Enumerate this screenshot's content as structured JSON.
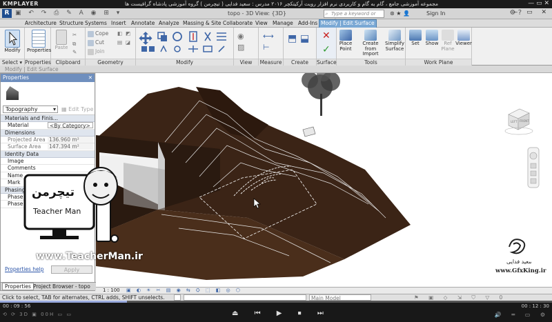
{
  "player": {
    "logo": "KMPLAYER",
    "title": "مجموعه آموزشی جامع ، گام به گام و کاربردی نرم افزار رویت آرکیتکچر ۲۰۱۶ مدرس : سعید فدایی ( تیچرمن ) گروه آموزشی پادشاه گرافیست ها",
    "elapsed": "00 : 09 : 56",
    "total": "00 : 12 : 30",
    "progress": 0.23,
    "left_buttons": "⟲ ⟳ 3D ▣ 00H ▭ ▭",
    "controls": "⏏ ⏮ ▶ ⏹ ⏭",
    "right_buttons": "🔊 ═ ▭ ⚙"
  },
  "revit": {
    "app_button": "R",
    "qat_icons": "▣ ↶ ↷ ⎙ ✎ A ◉ ⊞ ▾",
    "doc_title": "topo - 3D View: {3D}",
    "search_placeholder": "Type a keyword or phrase",
    "search_icon": "search-icon",
    "right_icons": "⊛ ★ 👤",
    "signin": "Sign In",
    "help_icons": "⚙ ?",
    "window_buttons": "— ▭ ✕",
    "tabs": [
      "Architecture",
      "Structure",
      "Systems",
      "Insert",
      "Annotate",
      "Analyze",
      "Massing & Site",
      "Collaborate",
      "View",
      "Manage",
      "Add-Ins",
      "Modify | Edit Surface"
    ],
    "active_tab": "Modify | Edit Surface",
    "groups": {
      "select": "Select ▾",
      "properties": "Properties",
      "clipboard": "Clipboard",
      "geometry": "Geometry",
      "modify": "Modify",
      "view": "View",
      "measure": "Measure",
      "create": "Create",
      "surface": "Surface",
      "tools": "Tools",
      "work_plane": "Work Plane"
    },
    "buttons": {
      "modify": "Modify",
      "properties": "Properties",
      "paste": "Paste",
      "cope": "Cope",
      "cut": "Cut",
      "join": "Join",
      "place_point": "Place Point",
      "create_from_import": "Create from Import",
      "simplify_surface": "Simplify Surface",
      "set": "Set",
      "show": "Show",
      "ref_plane": "Ref Plane",
      "viewer": "Viewer"
    },
    "context_bar": "Modify | Edit Surface",
    "properties_panel": {
      "title": "Properties",
      "close": "✕",
      "type": "Topography",
      "edit_type": "Edit Type",
      "sections": {
        "materials": "Materials and Finis...",
        "dimensions": "Dimensions",
        "identity": "Identity Data",
        "phasing": "Phasing"
      },
      "material_label": "Material",
      "material_value": "<By Category>",
      "projected_area_label": "Projected Area",
      "projected_area_value": "136.960 m²",
      "surface_area_label": "Surface Area",
      "surface_area_value": "147.394 m²",
      "image_label": "Image",
      "comments_label": "Comments",
      "name_label": "Name",
      "mark_label": "Mark",
      "phase_created_label": "Phase Created",
      "phase_demolished_label": "Phase Demolished",
      "help_link": "Properties help",
      "apply": "Apply",
      "tab_properties": "Properties",
      "tab_browser": "Project Browser - topo"
    },
    "view_bar": {
      "scale": "1 : 100",
      "icons": "▣ ◐ ☀ ✂ ▤ ◉ ⇆ ⛭ ⬚ ◧ ◎ ⬡"
    },
    "status": {
      "text": "Click to select, TAB for alternates, CTRL adds, SHIFT unselects.",
      "model": "Main Model",
      "tray_icons": "⚑ ▣ ◇ ⇲ ⛉ ▽ 0"
    },
    "viewcube": {
      "left": "LEFT",
      "front": "FRONT"
    }
  },
  "watermarks": {
    "teacherman_site": "www.TeacherMan.ir",
    "badge_name": "Teacher Man",
    "badge_fa": "تیچرمن",
    "gfx_site": "www.GfxKing.ir",
    "gfx_fa": "سعید فدایی"
  },
  "colors": {
    "terrain": "#3b2416",
    "terrain_dark": "#26160d",
    "accent": "#7aa8d4",
    "ribbon_blue": "#3e66a7"
  }
}
